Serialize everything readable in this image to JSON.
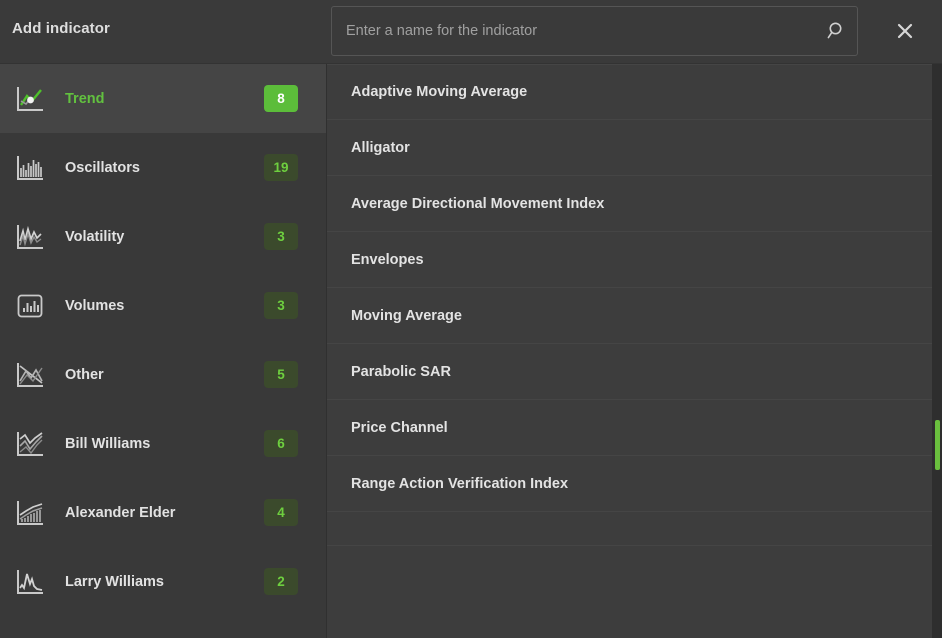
{
  "header": {
    "title": "Add indicator",
    "close_icon": "close-icon"
  },
  "search": {
    "value": "",
    "placeholder": "Enter a name for the indicator",
    "icon": "search-icon"
  },
  "sidebar": {
    "items": [
      {
        "label": "Trend",
        "count": "8",
        "icon": "trend-chart-icon",
        "active": true
      },
      {
        "label": "Oscillators",
        "count": "19",
        "icon": "oscillators-chart-icon",
        "active": false
      },
      {
        "label": "Volatility",
        "count": "3",
        "icon": "volatility-chart-icon",
        "active": false
      },
      {
        "label": "Volumes",
        "count": "3",
        "icon": "volumes-chart-icon",
        "active": false
      },
      {
        "label": "Other",
        "count": "5",
        "icon": "other-chart-icon",
        "active": false
      },
      {
        "label": "Bill Williams",
        "count": "6",
        "icon": "bill-williams-chart-icon",
        "active": false
      },
      {
        "label": "Alexander Elder",
        "count": "4",
        "icon": "alexander-elder-chart-icon",
        "active": false
      },
      {
        "label": "Larry Williams",
        "count": "2",
        "icon": "larry-williams-chart-icon",
        "active": false
      }
    ]
  },
  "list": {
    "items": [
      {
        "label": "Adaptive Moving Average"
      },
      {
        "label": "Alligator"
      },
      {
        "label": "Average Directional Movement Index"
      },
      {
        "label": "Envelopes"
      },
      {
        "label": "Moving Average"
      },
      {
        "label": "Parabolic SAR"
      },
      {
        "label": "Price Channel"
      },
      {
        "label": "Range Action Verification Index"
      }
    ]
  },
  "colors": {
    "accent_green": "#5cbd3a",
    "badge_green_text": "#6ecf3f",
    "badge_dark_bg": "#3b4a2c",
    "panel_bg": "#393939",
    "list_bg": "#3d3d3d",
    "scrollbar_thumb": "#6abf3e"
  }
}
